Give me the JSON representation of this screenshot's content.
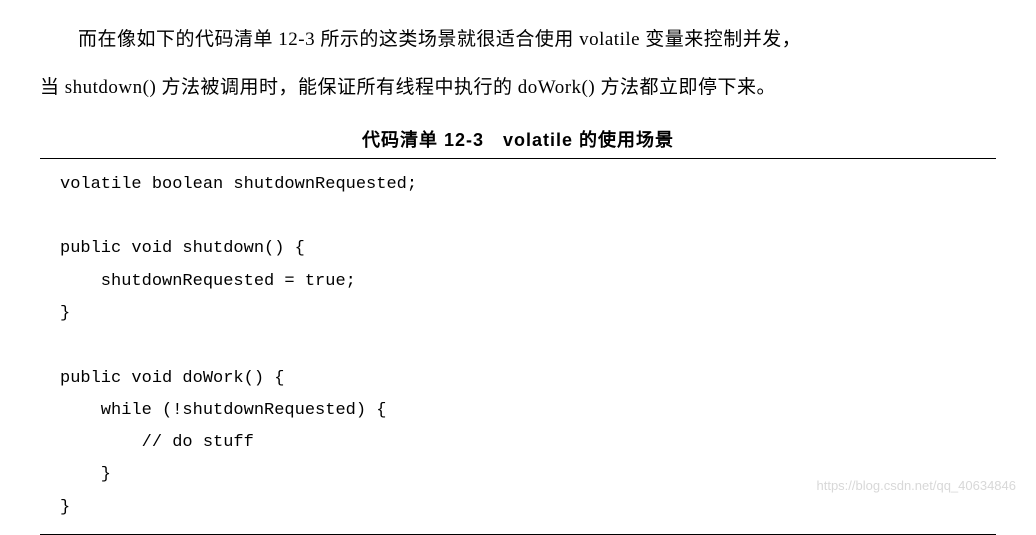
{
  "paragraph": {
    "line1": "而在像如下的代码清单 12-3 所示的这类场景就很适合使用 volatile 变量来控制并发，",
    "line2": "当 shutdown() 方法被调用时，能保证所有线程中执行的 doWork() 方法都立即停下来。"
  },
  "listing": {
    "title": "代码清单 12-3　volatile 的使用场景",
    "code": "volatile boolean shutdownRequested;\n\npublic void shutdown() {\n    shutdownRequested = true;\n}\n\npublic void doWork() {\n    while (!shutdownRequested) {\n        // do stuff\n    }\n}"
  },
  "watermark": "https://blog.csdn.net/qq_40634846"
}
